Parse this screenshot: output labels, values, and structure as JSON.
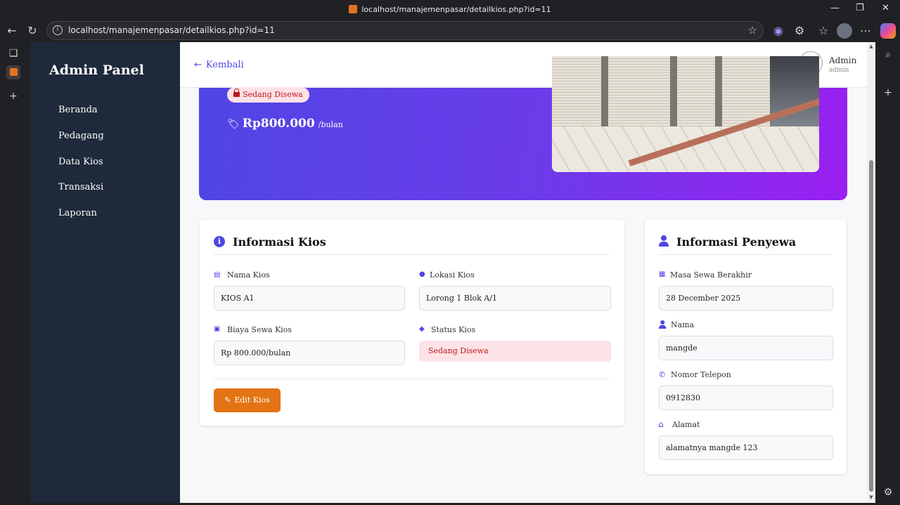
{
  "browser": {
    "tab_title": "localhost/manajemenpasar/detailkios.php?id=11",
    "url": "localhost/manajemenpasar/detailkios.php?id=11"
  },
  "sidebar": {
    "brand": "Admin Panel",
    "items": [
      {
        "label": "Beranda"
      },
      {
        "label": "Pedagang"
      },
      {
        "label": "Data Kios"
      },
      {
        "label": "Transaksi"
      },
      {
        "label": "Laporan"
      }
    ]
  },
  "topbar": {
    "back_label": "Kembali",
    "user_name": "Admin",
    "user_role": "admin"
  },
  "hero": {
    "status_badge": "Sedang Disewa",
    "price": "Rp800.000",
    "price_unit": "/bulan"
  },
  "kios_info": {
    "title": "Informasi Kios",
    "fields": {
      "nama": {
        "label": "Nama Kios",
        "value": "KIOS A1"
      },
      "lokasi": {
        "label": "Lokasi Kios",
        "value": "Lorong 1 Blok A/1"
      },
      "biaya": {
        "label": "Biaya Sewa Kios",
        "value": "Rp 800.000/bulan"
      },
      "status": {
        "label": "Status Kios",
        "value": "Sedang Disewa"
      }
    },
    "edit_button": "Edit Kios"
  },
  "penyewa_info": {
    "title": "Informasi Penyewa",
    "fields": {
      "masa": {
        "label": "Masa Sewa Berakhir",
        "value": "28 December 2025"
      },
      "nama": {
        "label": "Nama",
        "value": "mangde"
      },
      "telepon": {
        "label": "Nomor Telepon",
        "value": "0912830"
      },
      "alamat": {
        "label": "Alamat",
        "value": "alamatnya mangde 123"
      }
    }
  },
  "colors": {
    "accent": "#4f46e5",
    "sidebar": "#1e293b",
    "hero_start": "#4f46e5",
    "hero_end": "#9a1ff1",
    "edit_button": "#e37413",
    "status_bg": "#fde2e6",
    "status_text": "#b91c1c"
  }
}
